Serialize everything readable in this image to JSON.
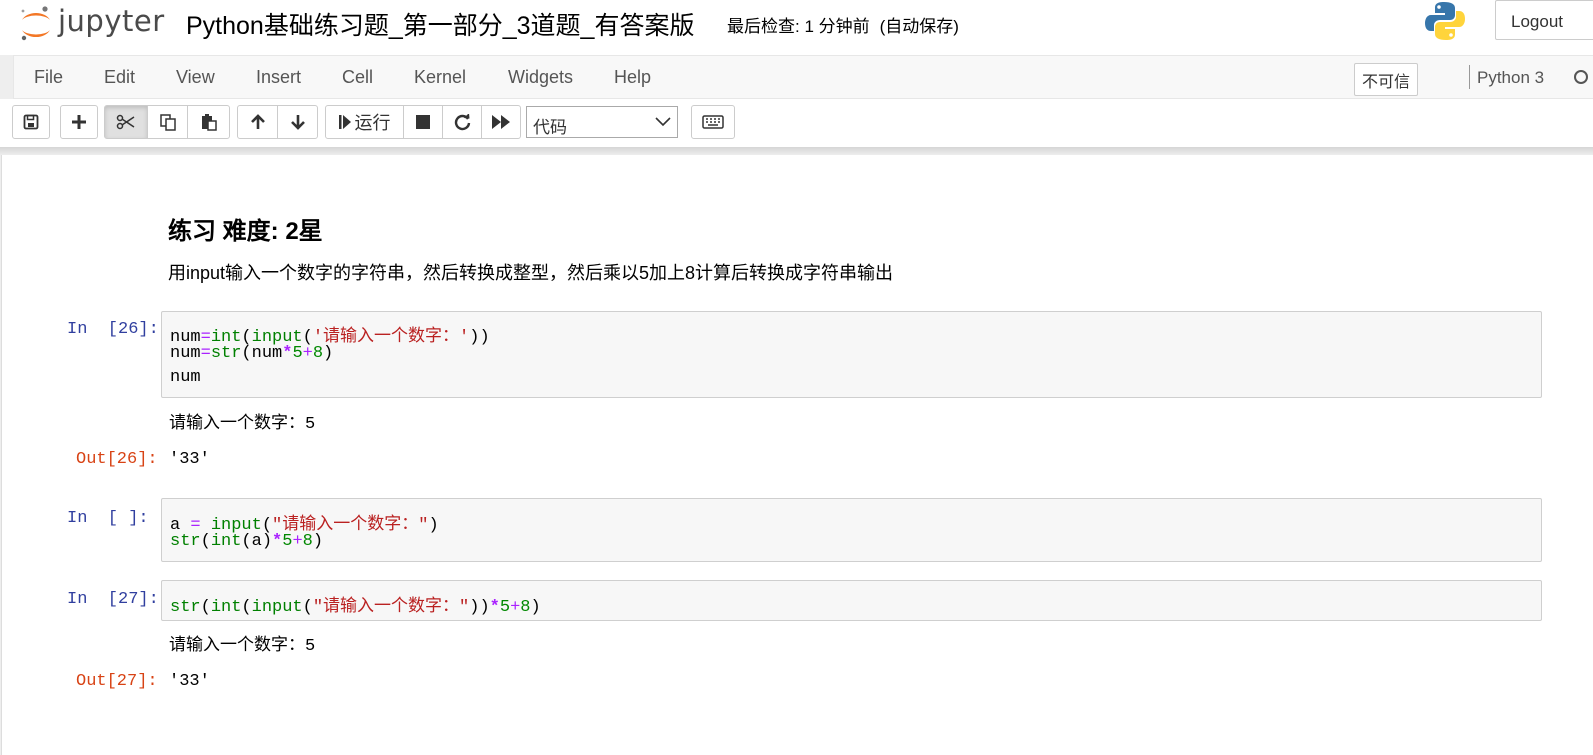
{
  "header": {
    "logo_text": "jupyter",
    "notebook_title": "Python基础练习题_第一部分_3道题_有答案版",
    "checkpoint_label": "最后检查: 1 分钟前",
    "autosave_label": "(自动保存)",
    "logout_label": "Logout",
    "colors": {
      "logo_orange": "#f37726",
      "python_blue": "#3776ab",
      "python_yellow": "#ffd43b"
    }
  },
  "menubar": {
    "items": [
      "File",
      "Edit",
      "View",
      "Insert",
      "Cell",
      "Kernel",
      "Widgets",
      "Help"
    ],
    "trust_label": "不可信",
    "kernel_name": "Python 3"
  },
  "toolbar": {
    "buttons": [
      "save-icon",
      "plus-icon",
      "cut-icon",
      "copy-icon",
      "paste-icon",
      "arrow-up-icon",
      "arrow-down-icon",
      "run-icon",
      "stop-icon",
      "restart-icon",
      "fast-forward-icon",
      "keyboard-icon"
    ],
    "run_label": "运行",
    "cell_type": "代码"
  },
  "cells": {
    "markdown": {
      "heading": "练习 难度: 2星",
      "paragraph": "用input输入一个数字的字符串，然后转换成整型，然后乘以5加上8计算后转换成字符串输出"
    },
    "cell1": {
      "prompt_in": "In  [26]:",
      "line1": {
        "a": "num",
        "b": "=",
        "c": "int",
        "d": "(",
        "e": "input",
        "f": "(",
        "g": "'请输入一个数字：'",
        "h": "))"
      },
      "line2": {
        "a": "num",
        "b": "=",
        "c": "str",
        "d": "(num",
        "e": "*",
        "f": "5",
        "g": "+",
        "h": "8",
        "i": ")"
      },
      "line3": "num",
      "stdout": "请输入一个数字：5",
      "prompt_out": "Out[26]:",
      "result": "'33'"
    },
    "cell2": {
      "prompt_in": "In  [ ]:",
      "line1": {
        "a": "a ",
        "b": "=",
        "c": " ",
        "d": "input",
        "e": "(",
        "f": "\"请输入一个数字：\"",
        "g": ")"
      },
      "line2": {
        "a": "str",
        "b": "(",
        "c": "int",
        "d": "(a)",
        "e": "*",
        "f": "5",
        "g": "+",
        "h": "8",
        "i": ")"
      }
    },
    "cell3": {
      "prompt_in": "In  [27]:",
      "line1": {
        "a": "str",
        "b": "(",
        "c": "int",
        "d": "(",
        "e": "input",
        "f": "(",
        "g": "\"请输入一个数字：\"",
        "h": "))",
        "i": "*",
        "j": "5",
        "k": "+",
        "l": "8",
        "m": ")"
      },
      "stdout": "请输入一个数字：5",
      "prompt_out": "Out[27]:",
      "result": "'33'"
    }
  }
}
